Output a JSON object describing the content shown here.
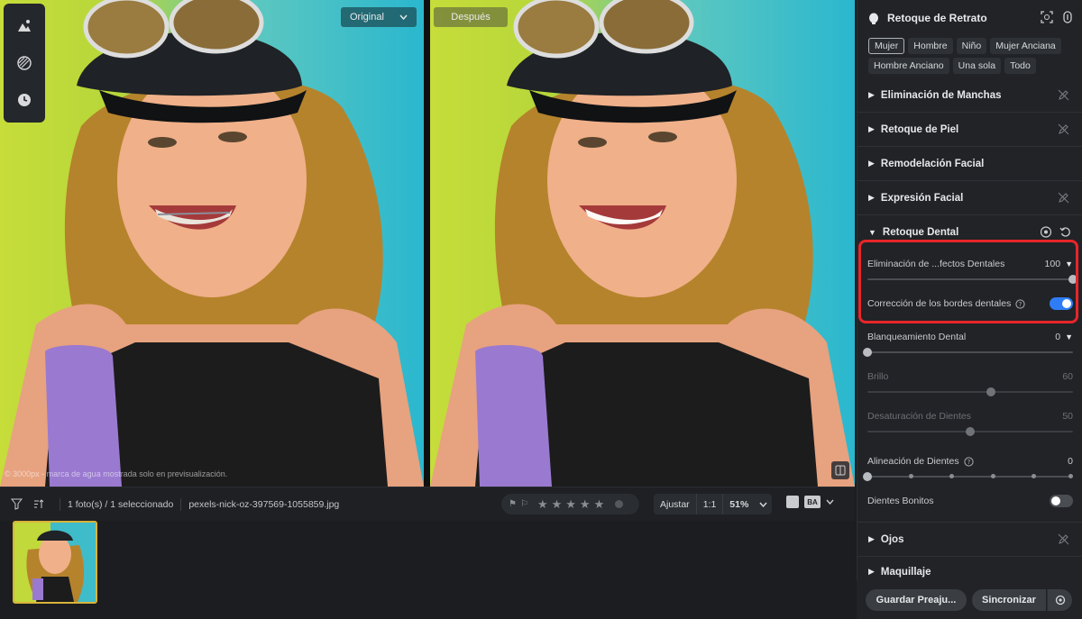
{
  "viewer": {
    "original_label": "Original",
    "after_label": "Después",
    "watermark_text": "© 3000px - marca de agua mostrada solo en previsualización."
  },
  "filmbar": {
    "count_text": "1 foto(s) / 1 seleccionado",
    "filename": "pexels-nick-oz-397569-1055859.jpg",
    "fit_label": "Ajustar",
    "one_to_one_label": "1:1",
    "zoom_value": "51%",
    "ba_label": "BA",
    "rating_stars": 5
  },
  "panel": {
    "title": "Retoque de Retrato",
    "tags": [
      "Mujer",
      "Hombre",
      "Niño",
      "Mujer Anciana",
      "Hombre Anciano",
      "Una sola",
      "Todo"
    ],
    "active_tag": "Mujer",
    "sections": {
      "spots": "Eliminación de Manchas",
      "skin": "Retoque de Piel",
      "reshape": "Remodelación Facial",
      "expression": "Expresión Facial",
      "dental": "Retoque Dental",
      "eyes": "Ojos",
      "makeup": "Maquillaje"
    },
    "dental": {
      "defects_label": "Eliminación de ...fectos Dentales",
      "defects_value": "100",
      "defects_level": 1.0,
      "edges_label": "Corrección de los bordes dentales",
      "edges_on": true,
      "whitening_label": "Blanqueamiento Dental",
      "whitening_value": "0",
      "whitening_level": 0.0,
      "brightness_label": "Brillo",
      "brightness_value": "60",
      "brightness_level": 0.6,
      "desaturation_label": "Desaturación de Dientes",
      "desaturation_value": "50",
      "desaturation_level": 0.5,
      "alignment_label": "Alineación de Dientes",
      "alignment_value": "0",
      "alignment_level": 0.0,
      "pretty_label": "Dientes Bonitos",
      "pretty_on": false
    },
    "buttons": {
      "save_preset": "Guardar Preaju...",
      "sync": "Sincronizar"
    }
  },
  "colors": {
    "accent": "#2f7df6",
    "highlight": "#e8262a",
    "thumb_border": "#d9b33a"
  }
}
